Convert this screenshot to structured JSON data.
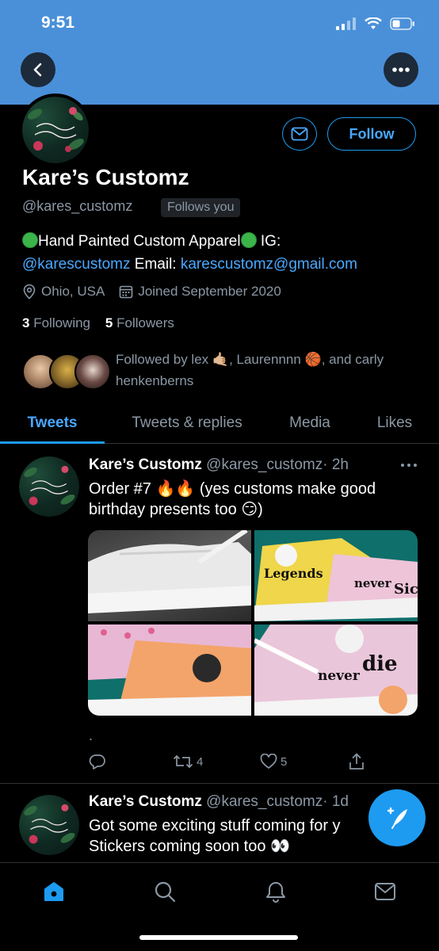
{
  "status_bar": {
    "time": "9:51"
  },
  "profile": {
    "name": "Kare’s Customz",
    "handle": "@kares_customz",
    "follows_you": "Follows you",
    "follow_label": "Follow",
    "bio_part1": "Hand Painted Custom Apparel",
    "bio_part2": " IG: ",
    "bio_ig": "@karescustomz",
    "bio_email_label": " Email: ",
    "bio_email": "karescustomz@gmail.com",
    "location": "Ohio, USA",
    "joined": "Joined September 2020",
    "following_count": "3",
    "following_label": "Following",
    "followers_count": "5",
    "followers_label": "Followers",
    "followed_by_prefix": "Followed by lex ",
    "followed_by_emoji1": "🤙🏼",
    "followed_by_mid": ", Laurennnn ",
    "followed_by_emoji2": "🏀",
    "followed_by_suffix": ", and carly henkenberns"
  },
  "tabs": [
    {
      "label": "Tweets"
    },
    {
      "label": "Tweets & replies"
    },
    {
      "label": "Media"
    },
    {
      "label": "Likes"
    }
  ],
  "tweets": [
    {
      "name": "Kare’s Customz",
      "handle": "@kares_customz",
      "time": "· 2h",
      "text_line1": "Order #7 🔥🔥 (yes customs make good",
      "text_line2": "birthday presents too 😏)",
      "dot": ".",
      "retweets": "4",
      "likes": "5",
      "media_labels": {
        "legends": "Legends",
        "never": "never",
        "die": "Sic",
        "never2": "never",
        "die2": "die"
      }
    },
    {
      "name": "Kare’s Customz",
      "handle": "@kares_customz",
      "time": "· 1d",
      "text_line1": "Got some exciting stuff coming for y",
      "text_line2": "Stickers coming soon too 👀"
    }
  ],
  "colors": {
    "accent": "#1d9bf0",
    "banner": "#4a90d9",
    "muted": "#8b98a5"
  },
  "icons": [
    "back-arrow-icon",
    "more-icon",
    "mail-icon",
    "location-icon",
    "calendar-icon",
    "reply-icon",
    "retweet-icon",
    "like-icon",
    "share-icon",
    "compose-icon",
    "home-icon",
    "search-icon",
    "notifications-icon",
    "messages-icon"
  ]
}
